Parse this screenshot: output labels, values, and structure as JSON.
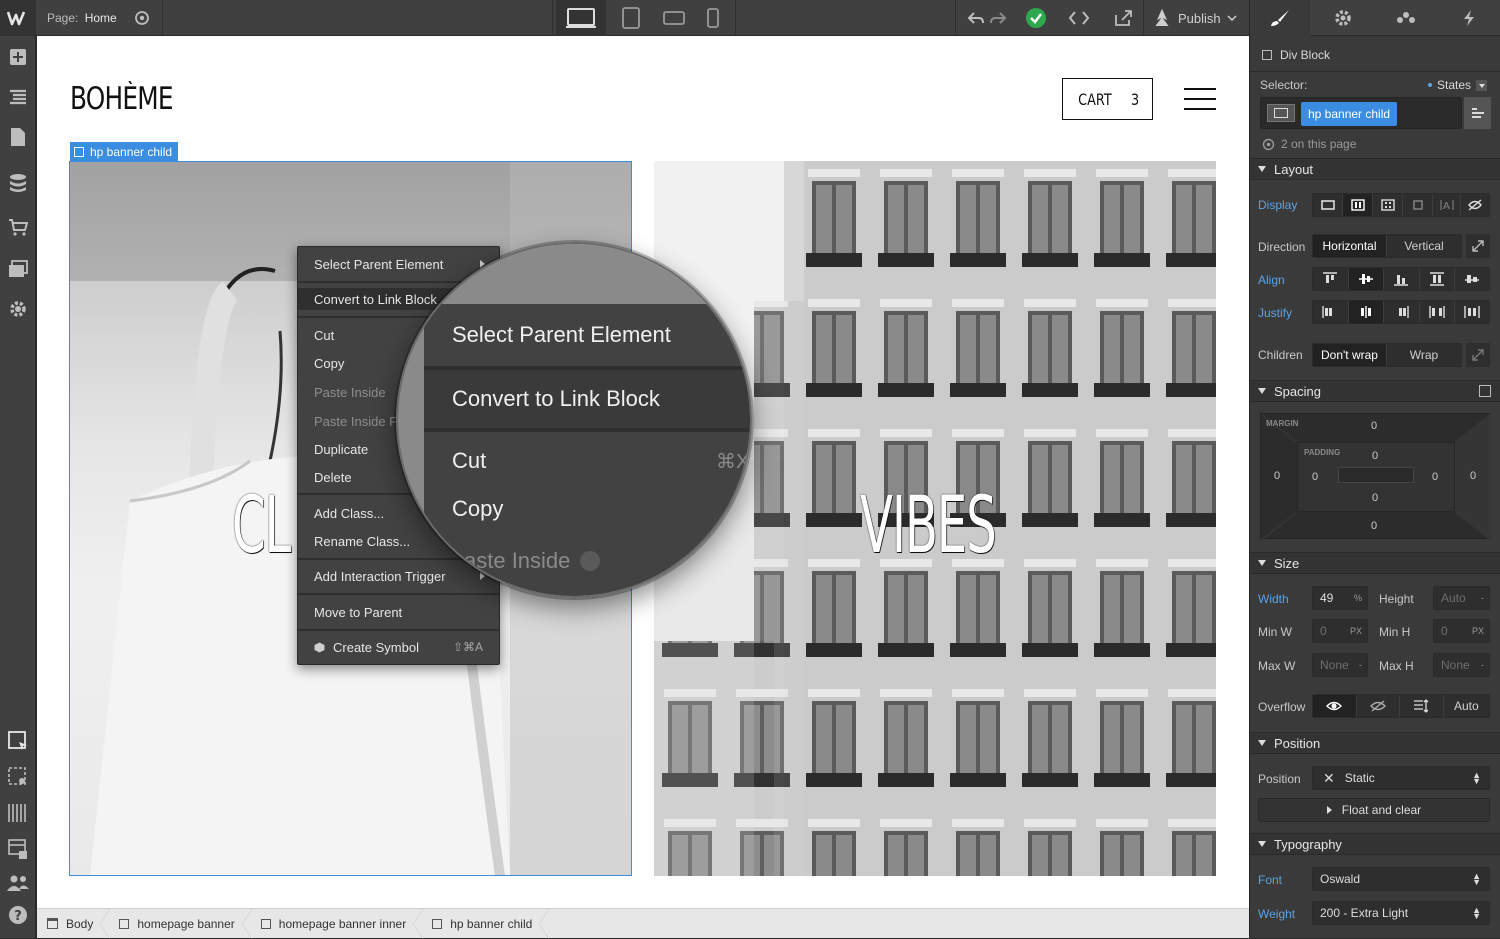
{
  "topbar": {
    "page_label": "Page:",
    "page_name": "Home",
    "publish_label": "Publish"
  },
  "canvas": {
    "logo": "BOHÈME",
    "cart_label": "CART",
    "cart_count": "3",
    "selection_tag": "hp banner child",
    "left_banner_text": "CL",
    "right_banner_text": "VIBES"
  },
  "context_menu": {
    "items": [
      {
        "label": "Select Parent Element"
      },
      {
        "label": "Convert to Link Block"
      },
      {
        "label": "Cut"
      },
      {
        "label": "Copy"
      },
      {
        "label": "Paste Inside"
      },
      {
        "label": "Paste Inside F"
      },
      {
        "label": "Duplicate"
      },
      {
        "label": "Delete"
      },
      {
        "label": "Add Class..."
      },
      {
        "label": "Rename Class..."
      },
      {
        "label": "Add Interaction Trigger"
      },
      {
        "label": "Move to Parent"
      },
      {
        "label": "Create Symbol",
        "shortcut": "⇧⌘A"
      }
    ]
  },
  "magnifier": {
    "items": [
      {
        "label": "Select Parent Element"
      },
      {
        "label": "Convert to Link Block"
      },
      {
        "label": "Cut",
        "shortcut": "⌘X"
      },
      {
        "label": "Copy"
      },
      {
        "label": "aste Inside"
      }
    ]
  },
  "breadcrumbs": [
    "Body",
    "homepage banner",
    "homepage banner inner",
    "hp banner child"
  ],
  "panel": {
    "element_type": "Div Block",
    "selector_label": "Selector:",
    "states_label": "States",
    "selector_class": "hp banner child",
    "page_count": "2 on this page",
    "layout": {
      "title": "Layout",
      "display_label": "Display",
      "direction_label": "Direction",
      "direction_options": [
        "Horizontal",
        "Vertical"
      ],
      "align_label": "Align",
      "justify_label": "Justify",
      "children_label": "Children",
      "children_options": [
        "Don't wrap",
        "Wrap"
      ]
    },
    "spacing": {
      "title": "Spacing",
      "margin_label": "MARGIN",
      "padding_label": "PADDING",
      "margin": {
        "top": "0",
        "right": "0",
        "bottom": "0",
        "left": "0"
      },
      "padding": {
        "top": "0",
        "right": "0",
        "bottom": "0",
        "left": "0"
      }
    },
    "size": {
      "title": "Size",
      "width_label": "Width",
      "width_value": "49",
      "width_unit": "%",
      "height_label": "Height",
      "height_value": "Auto",
      "height_unit": "-",
      "minw_label": "Min W",
      "minw_value": "0",
      "minw_unit": "PX",
      "minh_label": "Min H",
      "minh_value": "0",
      "minh_unit": "PX",
      "maxw_label": "Max W",
      "maxw_value": "None",
      "maxw_unit": "-",
      "maxh_label": "Max H",
      "maxh_value": "None",
      "maxh_unit": "-",
      "overflow_label": "Overflow",
      "overflow_auto": "Auto"
    },
    "position": {
      "title": "Position",
      "position_label": "Position",
      "position_value": "Static",
      "float_label": "Float and clear"
    },
    "typography": {
      "title": "Typography",
      "font_label": "Font",
      "font_value": "Oswald",
      "weight_label": "Weight",
      "weight_value": "200 - Extra Light"
    }
  },
  "colors": {
    "accent_blue": "#3a8de0",
    "published_green": "#2ea84f"
  }
}
